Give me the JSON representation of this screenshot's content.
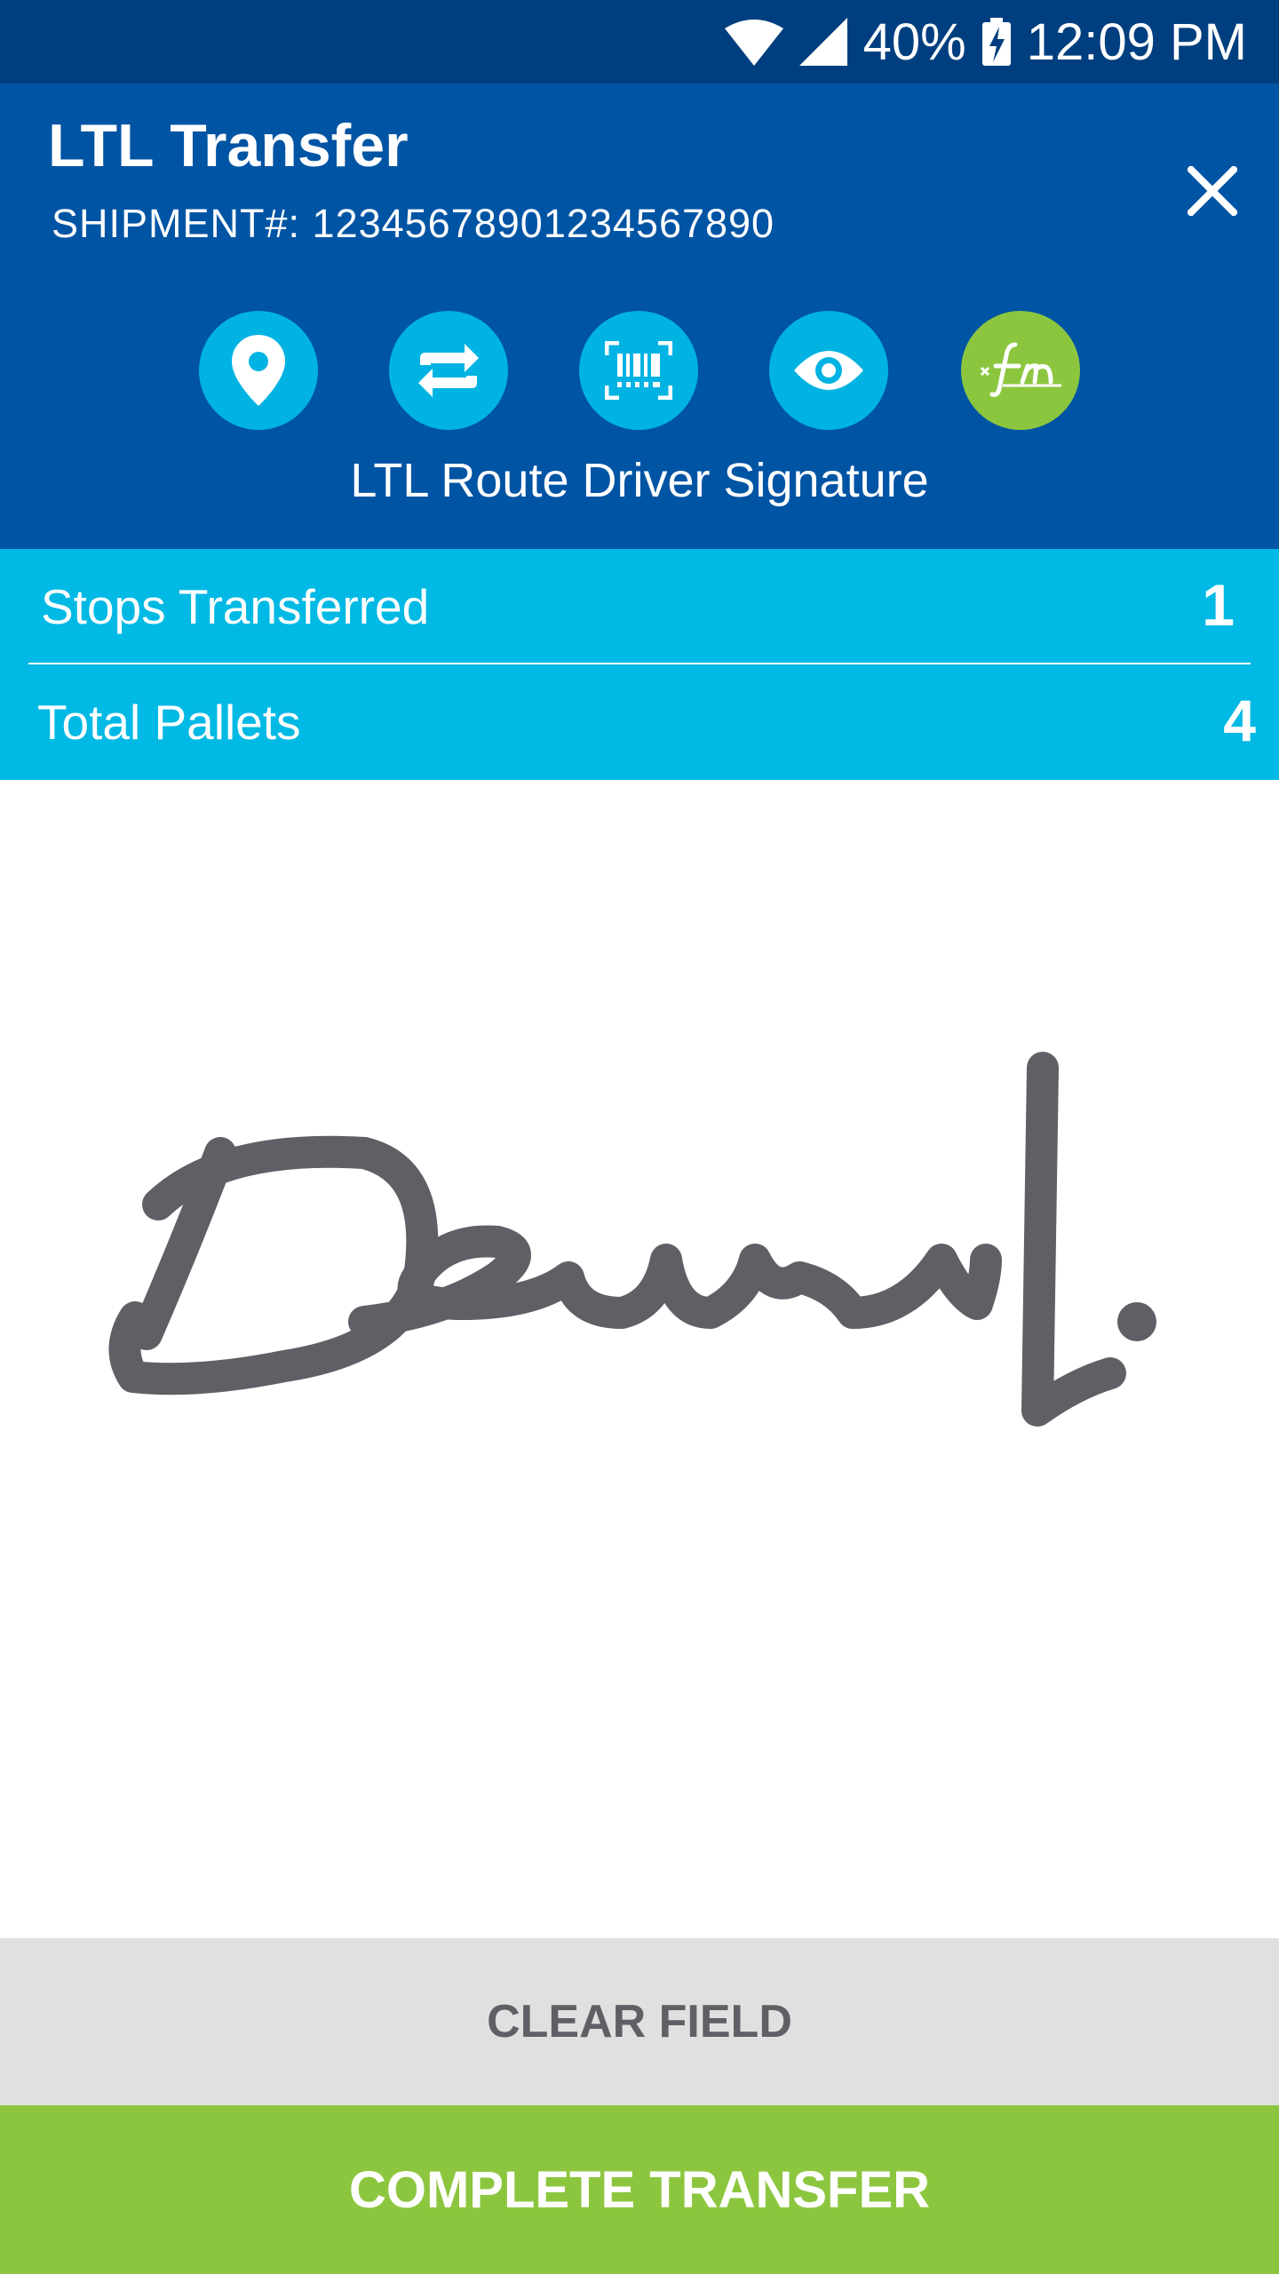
{
  "status_bar": {
    "battery_percent": "40%",
    "time": "12:09 PM",
    "icons": [
      "wifi-icon",
      "cell-signal-icon",
      "battery-charging-icon"
    ]
  },
  "header": {
    "title": "LTL Transfer",
    "shipment": "SHIPMENT#: 12345678901234567890",
    "close_icon": "close-icon",
    "steps": [
      {
        "icon": "location-pin-icon"
      },
      {
        "icon": "transfer-arrows-icon"
      },
      {
        "icon": "barcode-scan-icon"
      },
      {
        "icon": "eye-icon"
      },
      {
        "icon": "signature-icon",
        "active": true
      }
    ],
    "step_caption": "LTL Route Driver Signature"
  },
  "summary": {
    "rows": [
      {
        "label": "Stops Transferred",
        "value": "1"
      },
      {
        "label": "Total Pallets",
        "value": "4"
      }
    ]
  },
  "signature_pad": {
    "stroke_color": "#5f6066"
  },
  "actions": {
    "clear_label": "CLEAR FIELD",
    "complete_label": "COMPLETE TRANSFER"
  },
  "colors": {
    "status_bar": "#003f7f",
    "header": "#0054a4",
    "step_icon": "#00b3e3",
    "step_active": "#8cc63f",
    "summary": "#00b9e4",
    "clear_button": "#e0e0e0",
    "complete_button": "#8cc63f"
  }
}
